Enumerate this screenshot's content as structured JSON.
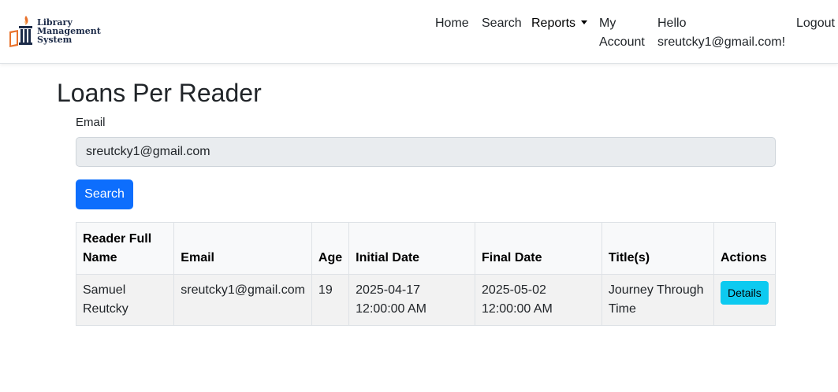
{
  "brand": {
    "lines": [
      "Library",
      "Management",
      "System"
    ]
  },
  "nav": {
    "home": "Home",
    "search": "Search",
    "reports": "Reports",
    "my_account": "My Account",
    "hello": "Hello sreutcky1@gmail.com!",
    "logout": "Logout"
  },
  "page": {
    "title": "Loans Per Reader",
    "email_label": "Email",
    "email_value": "sreutcky1@gmail.com",
    "search_button": "Search"
  },
  "table": {
    "headers": [
      "Reader Full Name",
      "Email",
      "Age",
      "Initial Date",
      "Final Date",
      "Title(s)",
      "Actions"
    ],
    "rows": [
      {
        "name": "Samuel Reutcky",
        "email": "sreutcky1@gmail.com",
        "age": "19",
        "initial_date": "2025-04-17 12:00:00 AM",
        "final_date": "2025-05-02 12:00:00 AM",
        "titles": "Journey Through Time",
        "action": "Details"
      }
    ]
  },
  "colors": {
    "primary": "#0d6efd",
    "info": "#0dcaf0",
    "logo_flame": "#e8722c",
    "logo_navy": "#1b2a48"
  }
}
